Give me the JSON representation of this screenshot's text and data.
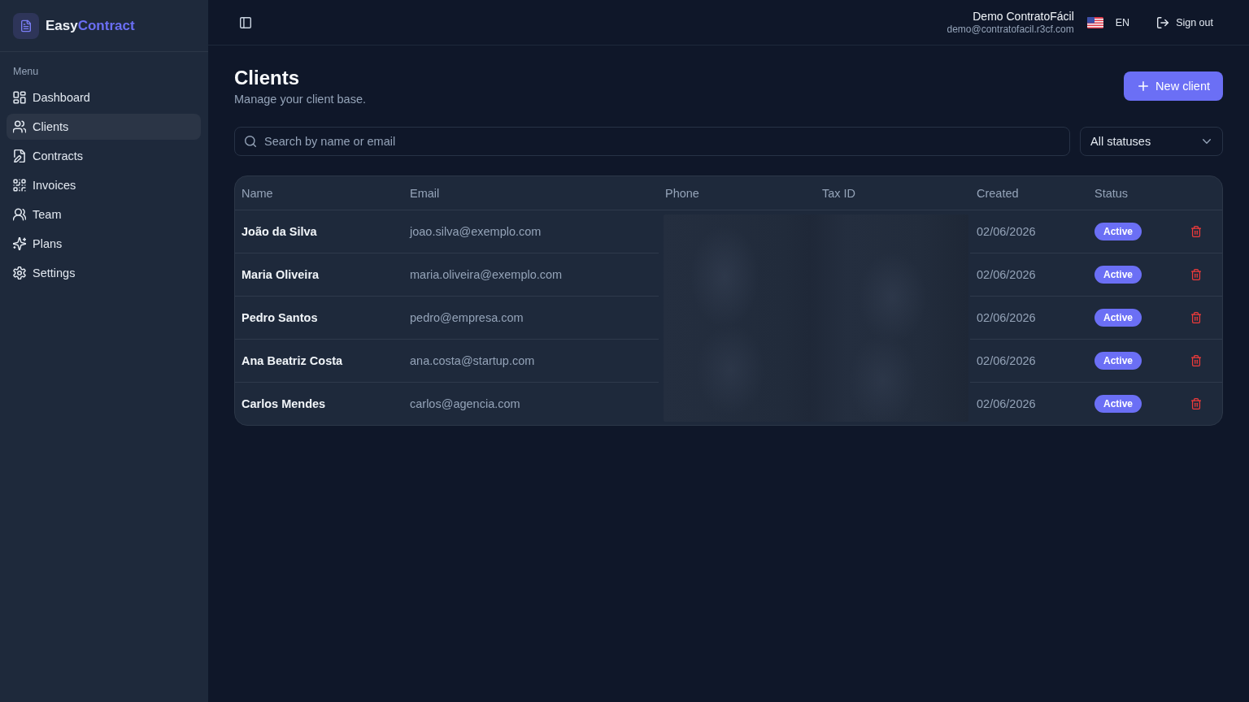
{
  "sidebar": {
    "brand": {
      "name_start": "Easy",
      "name_end": "Contract"
    },
    "section_label": "Menu",
    "items": [
      {
        "label": "Dashboard",
        "selected": false
      },
      {
        "label": "Clients",
        "selected": true
      },
      {
        "label": "Contracts",
        "selected": false
      },
      {
        "label": "Invoices",
        "selected": false
      },
      {
        "label": "Team",
        "selected": false
      },
      {
        "label": "Plans",
        "selected": false
      },
      {
        "label": "Settings",
        "selected": false
      }
    ]
  },
  "header": {
    "user": {
      "name": "Demo ContratoFácil",
      "email": "demo@contratofacil.r3cf.com"
    },
    "language": "EN",
    "sign_out": "Sign out"
  },
  "page": {
    "title": "Clients",
    "subtitle": "Manage your client base.",
    "new_button": "New client",
    "search": {
      "placeholder": "Search by name or email"
    },
    "status_filter": {
      "value": "All statuses"
    }
  },
  "table": {
    "columns": [
      {
        "label": "Name",
        "redacted": false
      },
      {
        "label": "Email",
        "redacted": false
      },
      {
        "label": "Phone",
        "redacted": true
      },
      {
        "label": "Tax ID",
        "redacted": true
      },
      {
        "label": "Created",
        "redacted": false
      },
      {
        "label": "Status",
        "redacted": false
      }
    ],
    "rows": [
      {
        "name": "João da Silva",
        "email": "joao.silva@exemplo.com",
        "created": "02/06/2026",
        "status": "Active"
      },
      {
        "name": "Maria Oliveira",
        "email": "maria.oliveira@exemplo.com",
        "created": "02/06/2026",
        "status": "Active"
      },
      {
        "name": "Pedro Santos",
        "email": "pedro@empresa.com",
        "created": "02/06/2026",
        "status": "Active"
      },
      {
        "name": "Ana Beatriz Costa",
        "email": "ana.costa@startup.com",
        "created": "02/06/2026",
        "status": "Active"
      },
      {
        "name": "Carlos Mendes",
        "email": "carlos@agencia.com",
        "created": "02/06/2026",
        "status": "Active"
      }
    ]
  }
}
